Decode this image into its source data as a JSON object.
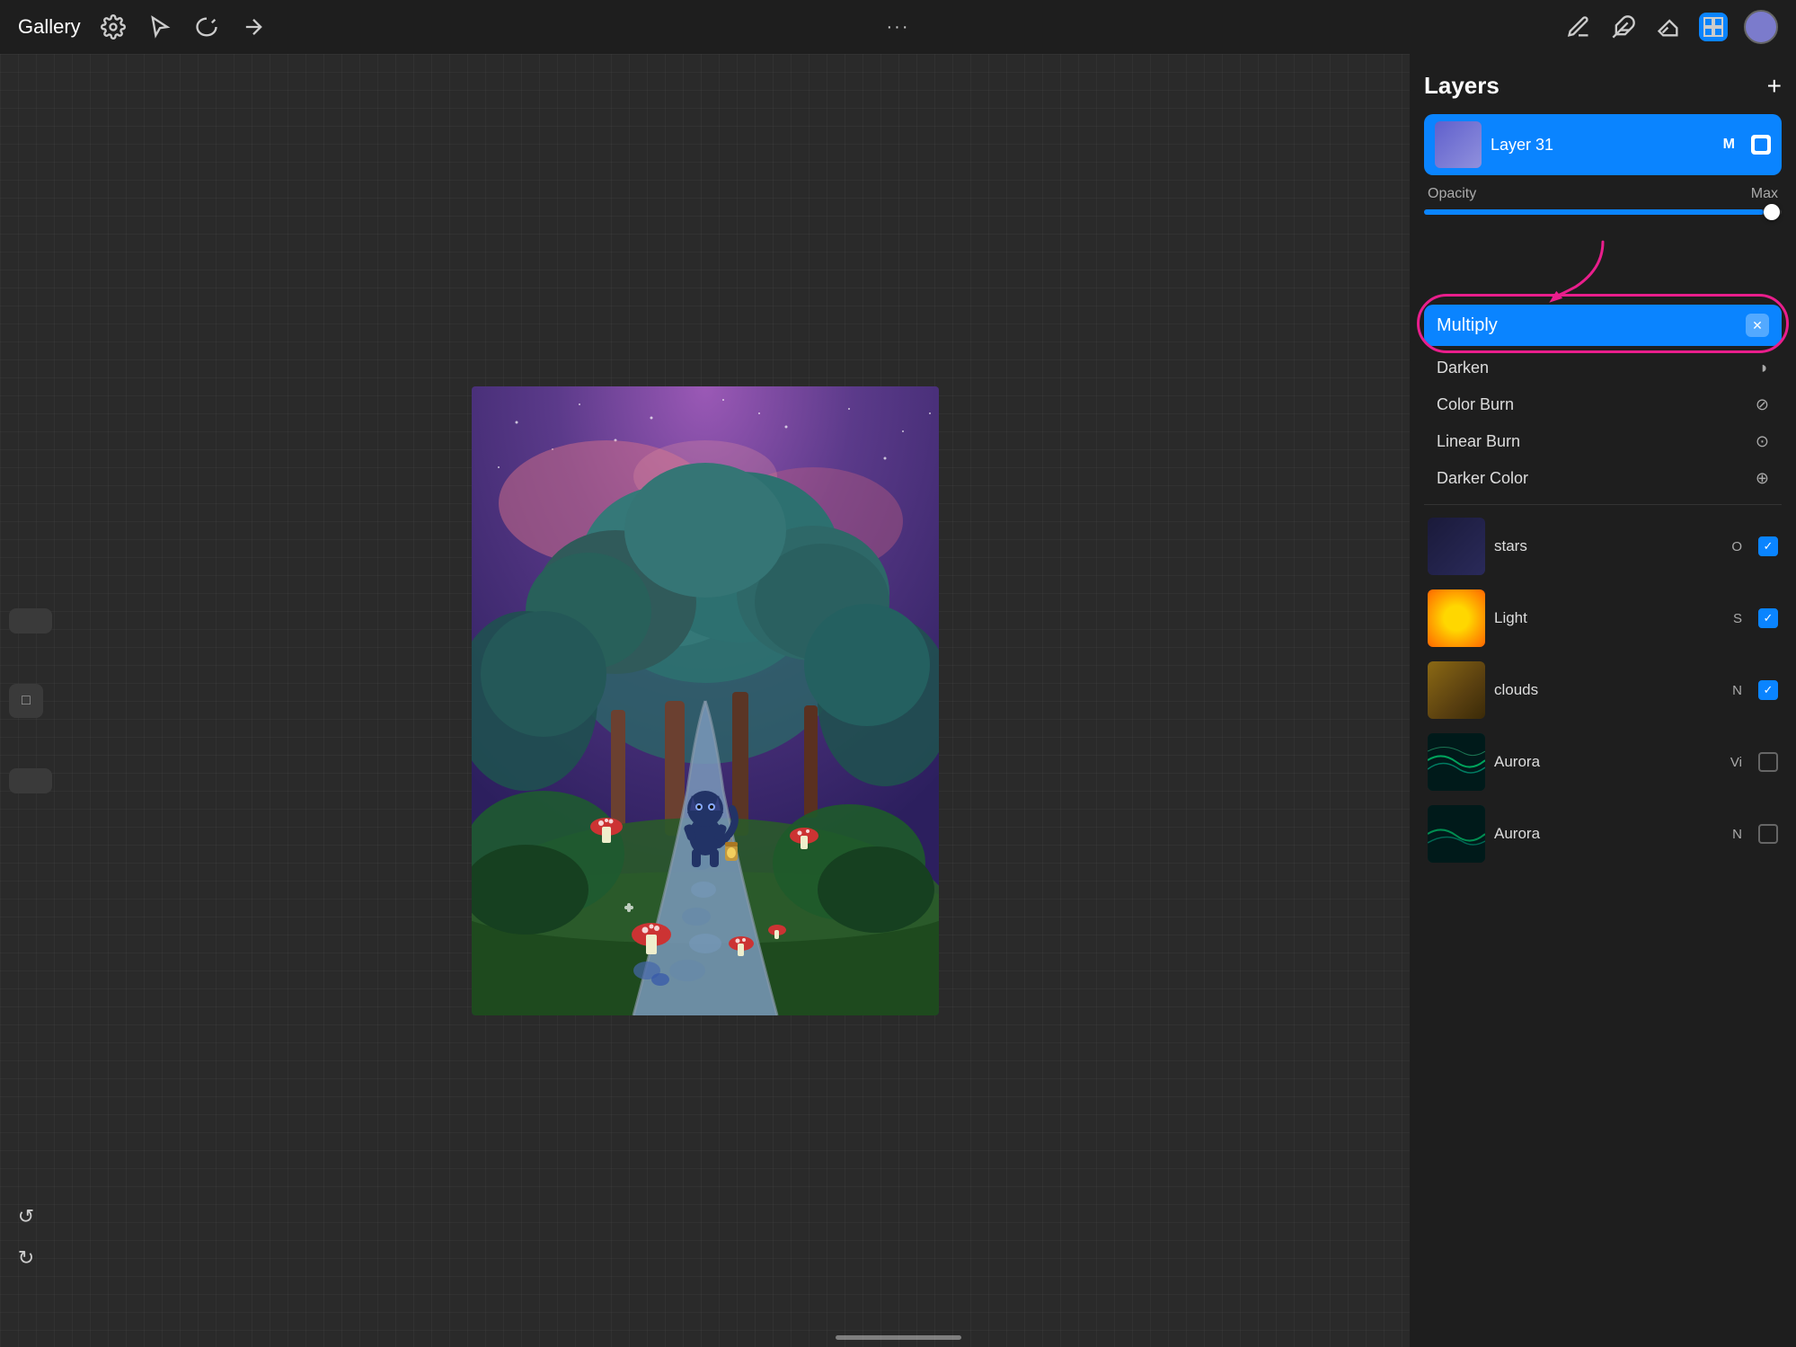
{
  "toolbar": {
    "gallery_label": "Gallery",
    "dots": "···",
    "add_label": "+"
  },
  "layers_panel": {
    "title": "Layers",
    "active_layer": {
      "name": "Layer 31",
      "mode": "M",
      "opacity_label": "Opacity",
      "opacity_value": "Max"
    },
    "blend_modes": {
      "selected": "Multiply",
      "list": [
        {
          "name": "Darken",
          "icon": "◗"
        },
        {
          "name": "Color Burn",
          "icon": "⊘"
        },
        {
          "name": "Linear Burn",
          "icon": "⊙"
        },
        {
          "name": "Darker Color",
          "icon": "⊕"
        }
      ]
    },
    "layers": [
      {
        "name": "stars",
        "mode": "O",
        "checked": true,
        "thumb_class": "thumb-stars"
      },
      {
        "name": "Light",
        "mode": "S",
        "checked": true,
        "thumb_class": "thumb-light"
      },
      {
        "name": "clouds",
        "mode": "N",
        "checked": true,
        "thumb_class": "thumb-clouds"
      },
      {
        "name": "Aurora",
        "mode": "Vi",
        "checked": false,
        "thumb_class": "thumb-aurora1"
      },
      {
        "name": "Aurora",
        "mode": "N",
        "checked": false,
        "thumb_class": "thumb-aurora2"
      }
    ]
  },
  "colors": {
    "active_blue": "#0a84ff",
    "pink_arrow": "#e91e8c",
    "accent_purple": "#7b7bcc"
  }
}
